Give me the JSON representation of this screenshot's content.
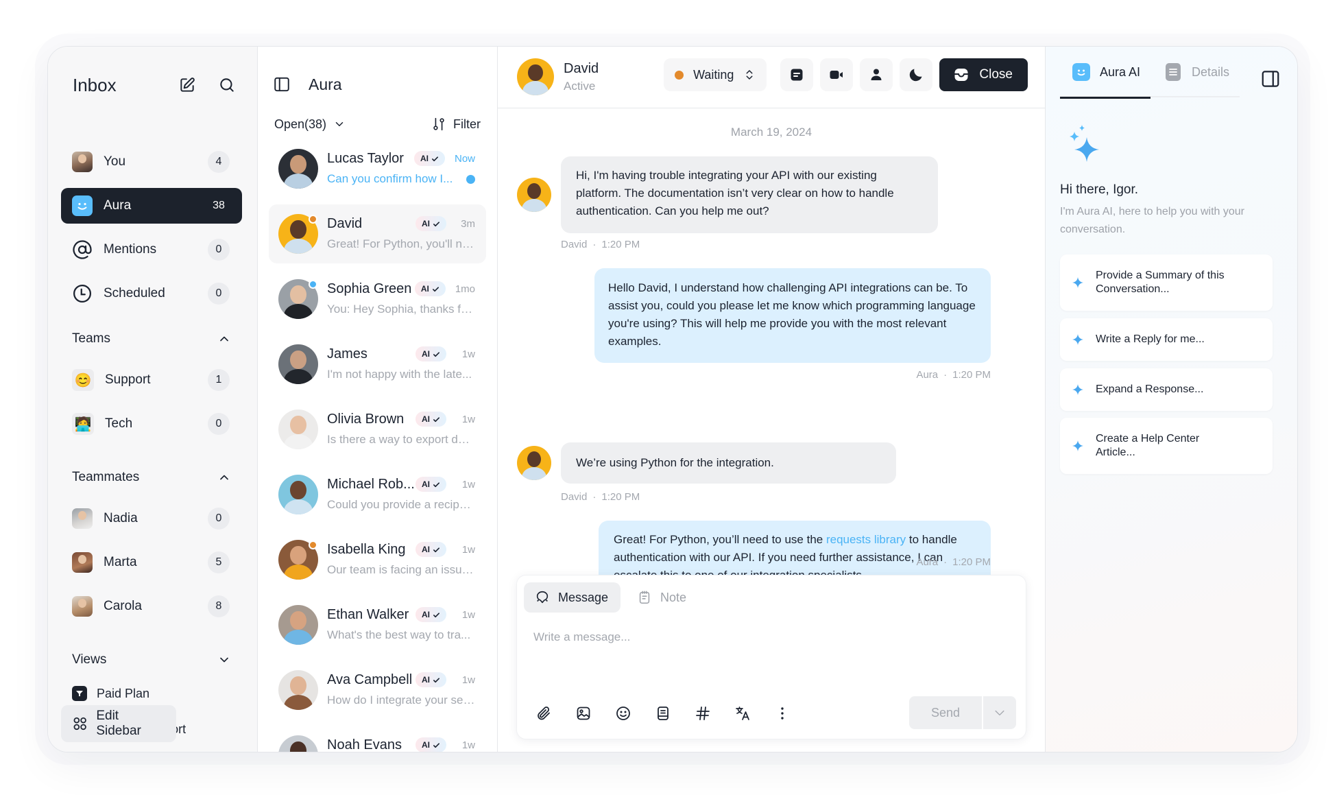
{
  "sidebar": {
    "title": "Inbox",
    "items": [
      {
        "label": "You",
        "count": "4"
      },
      {
        "label": "Aura",
        "count": "38"
      },
      {
        "label": "Mentions",
        "count": "0"
      },
      {
        "label": "Scheduled",
        "count": "0"
      }
    ],
    "teams": {
      "label": "Teams",
      "items": [
        {
          "label": "Support",
          "count": "1",
          "emoji": "😊"
        },
        {
          "label": "Tech",
          "count": "0",
          "emoji": "🧑‍💻"
        }
      ]
    },
    "teammates": {
      "label": "Teammates",
      "items": [
        {
          "label": "Nadia",
          "count": "0"
        },
        {
          "label": "Marta",
          "count": "5"
        },
        {
          "label": "Carola",
          "count": "8"
        }
      ]
    },
    "views": {
      "label": "Views",
      "items": [
        {
          "label": "Paid Plan"
        },
        {
          "label": "Sales & Support"
        }
      ]
    },
    "edit_label": "Edit Sidebar"
  },
  "conversation_list": {
    "title": "Aura",
    "status_filter": "Open(38)",
    "filter_label": "Filter",
    "ai_badge": "AI",
    "conversations": [
      {
        "name": "Lucas Taylor",
        "time": "Now",
        "preview": "Can you confirm how I...",
        "unread": true
      },
      {
        "name": "David",
        "time": "3m",
        "preview": "Great! For Python, you'll ne...",
        "status_dot": "orange"
      },
      {
        "name": "Sophia Green",
        "time": "1mo",
        "preview": "You: Hey Sophia, thanks fo...",
        "status_dot": "blue"
      },
      {
        "name": "James",
        "time": "1w",
        "preview": "I'm not happy with the late..."
      },
      {
        "name": "Olivia Brown",
        "time": "1w",
        "preview": "Is there a way to export dat..."
      },
      {
        "name": "Michael Rob...",
        "time": "1w",
        "preview": "Could you provide a recipe..."
      },
      {
        "name": "Isabella King",
        "time": "1w",
        "preview": "Our team is facing an issue...",
        "status_dot": "orange"
      },
      {
        "name": "Ethan Walker",
        "time": "1w",
        "preview": "What's the best way to tra..."
      },
      {
        "name": "Ava Campbell",
        "time": "1w",
        "preview": "How do I integrate your ser..."
      },
      {
        "name": "Noah Evans",
        "time": "1w",
        "preview": ""
      }
    ]
  },
  "chat": {
    "contact_name": "David",
    "contact_status": "Active",
    "conversation_status": "Waiting",
    "close_label": "Close",
    "date": "March 19, 2024",
    "messages": [
      {
        "from": "David",
        "direction": "in",
        "time": "1:20 PM",
        "text": "Hi, I'm having trouble integrating your API with our existing platform. The documentation isn’t very clear on how to handle authentication. Can you help me out?"
      },
      {
        "from": "Aura",
        "direction": "out",
        "time": "1:20 PM",
        "text": "Hello David, I understand how challenging API integrations can be. To assist you, could you please let me know which programming language you're using? This will help me provide you with the most relevant examples."
      },
      {
        "from": "David",
        "direction": "in",
        "time": "1:20 PM",
        "text": "We’re using Python for the integration."
      },
      {
        "from": "Aura",
        "direction": "out",
        "time": "1:20 PM",
        "text_before": "Great! For Python, you’ll need to use the ",
        "link": "requests library",
        "text_after": " to handle authentication with our API. If you need further assistance, I can escalate this to one of our integration specialists."
      }
    ],
    "composer": {
      "tabs": [
        "Message",
        "Note"
      ],
      "placeholder": "Write a message...",
      "send_label": "Send"
    }
  },
  "ai_panel": {
    "tabs": [
      "Aura AI",
      "Details"
    ],
    "greeting": "Hi there, Igor.",
    "intro": "I'm Aura AI, here to help you with your conversation.",
    "suggestions": [
      "Provide a Summary of this Conversation...",
      "Write a Reply for me...",
      "Expand a Response...",
      "Create a Help Center Article..."
    ]
  },
  "colors": {
    "accent_blue": "#4ab3f5",
    "aura_face": "#59bdfb",
    "dark": "#1c222c",
    "status_waiting": "#e38a2c",
    "outgoing_bubble": "#dcf0fe",
    "incoming_bubble": "#eeeff1"
  }
}
